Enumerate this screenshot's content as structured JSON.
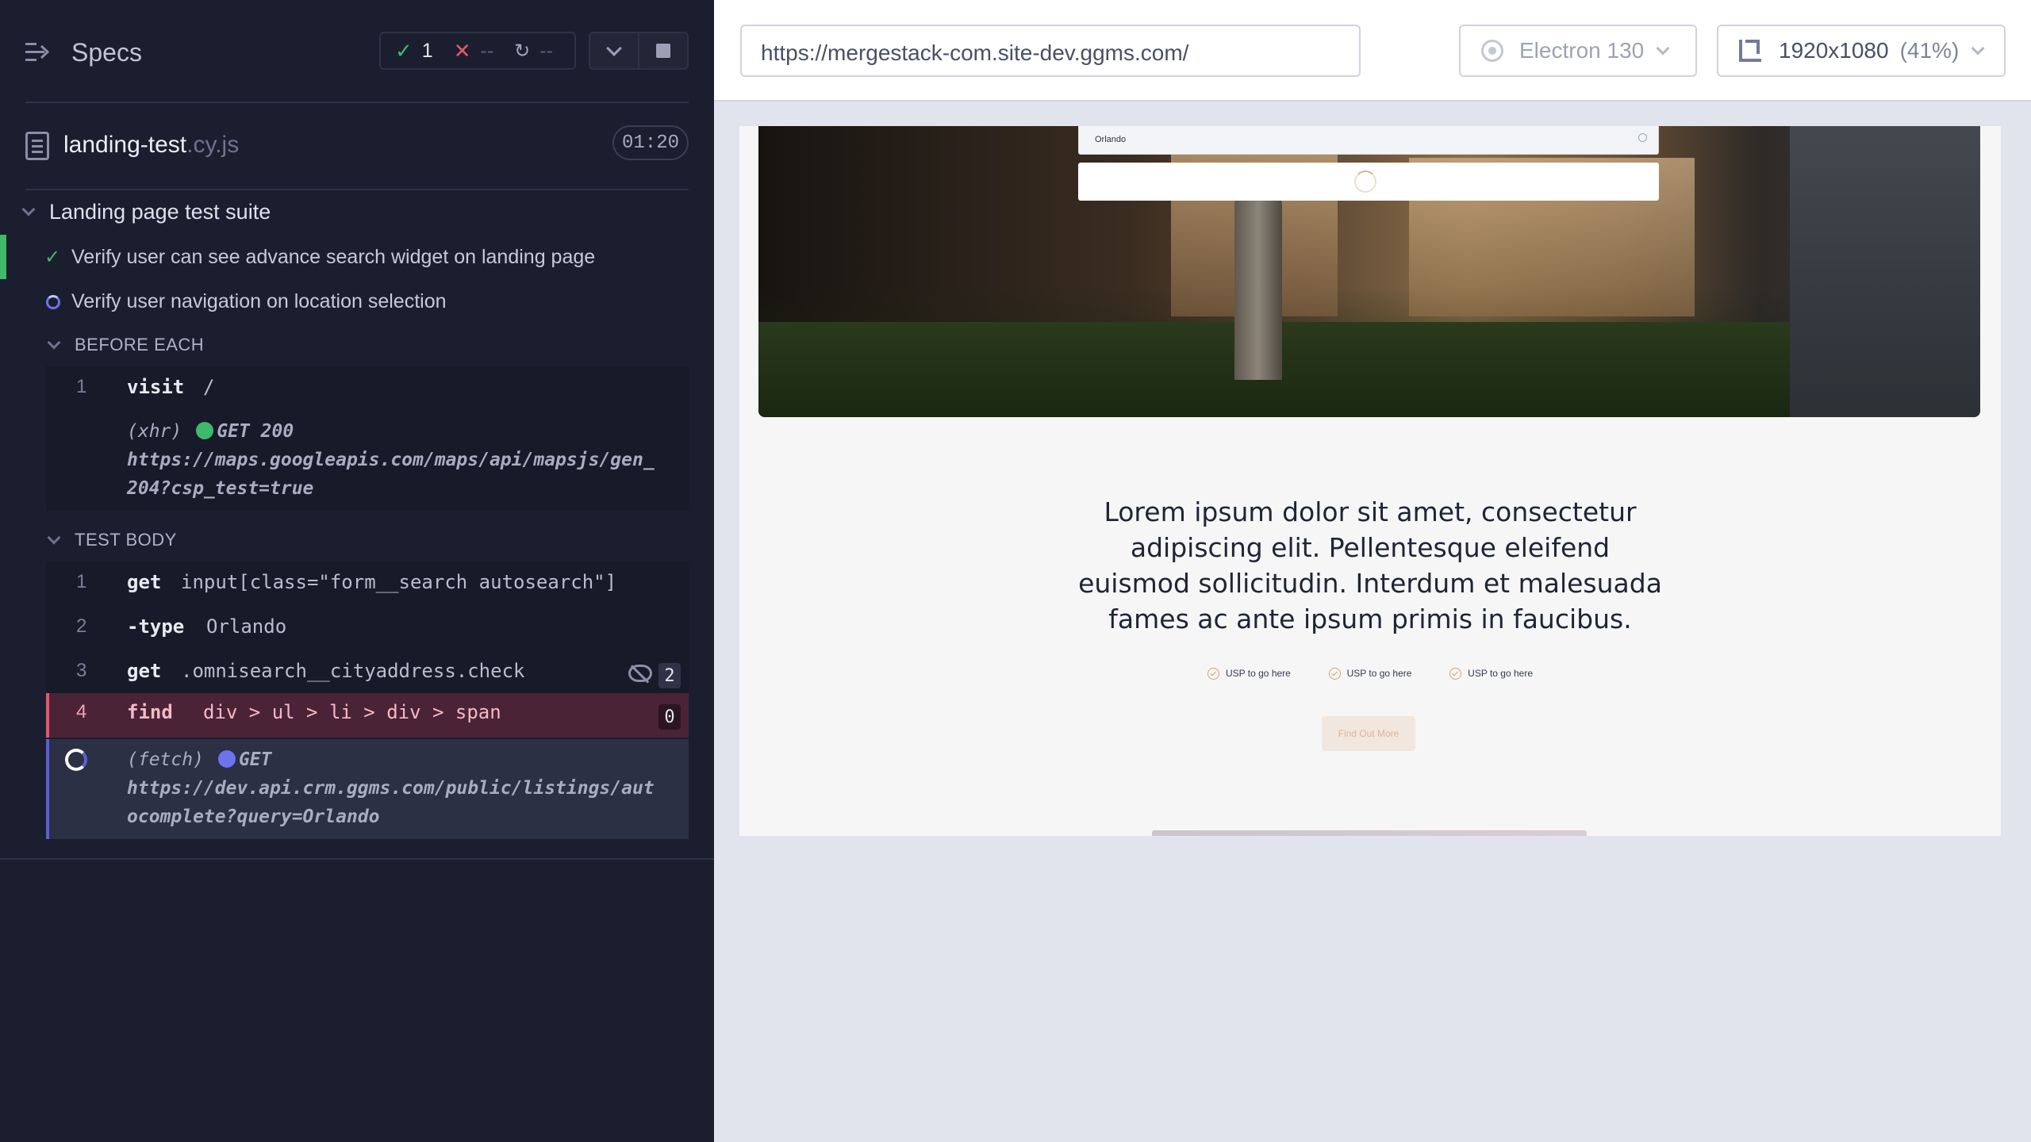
{
  "reporter": {
    "title": "Specs",
    "stats": {
      "passed": "1",
      "failed": "--",
      "pending": "--"
    },
    "spec": {
      "name": "landing-test",
      "ext": ".cy.js",
      "duration": "01:20"
    },
    "suite": {
      "title": "Landing page test suite"
    },
    "tests": [
      {
        "title": "Verify user can see advance search widget on landing page",
        "state": "passed"
      },
      {
        "title": "Verify user navigation on location selection",
        "state": "running"
      }
    ],
    "before_each": {
      "label": "BEFORE EACH",
      "commands": [
        {
          "num": "1",
          "name": "visit",
          "message": "/"
        }
      ],
      "request": {
        "type": "(xhr)",
        "status": "GET 200",
        "url_line1": "https://maps.googleapis.com/maps/api/mapsjs/gen_",
        "url_line2": "204?csp_test=true"
      }
    },
    "test_body": {
      "label": "TEST BODY",
      "commands": [
        {
          "num": "1",
          "name": "get",
          "message": "input[class=\"form__search autosearch\"]"
        },
        {
          "num": "2",
          "name": "-type",
          "message": "Orlando"
        },
        {
          "num": "3",
          "name": "get",
          "message": ".omnisearch__cityaddress.check",
          "badge": "2"
        },
        {
          "num": "4",
          "name": "find",
          "message": "div > ul > li > div > span",
          "badge": "0",
          "state": "failed"
        }
      ],
      "request": {
        "type": "(fetch)",
        "status": "GET",
        "url_line1": "https://dev.api.crm.ggms.com/public/listings/aut",
        "url_line2": "ocomplete?query=Orlando"
      }
    }
  },
  "aut": {
    "url": "https://mergestack-com.site-dev.ggms.com/",
    "browser": "Electron 130",
    "viewport": "1920x1080",
    "scale": "(41%)",
    "page": {
      "search_value": "Orlando",
      "headline": "Lorem ipsum dolor sit amet, consectetur adipiscing elit. Pellentesque eleifend euismod sollicitudin. Interdum et malesuada fames ac ante ipsum primis in faucibus.",
      "usps": [
        "USP to go here",
        "USP to go here",
        "USP to go here"
      ],
      "cta": "Find Out More"
    }
  }
}
